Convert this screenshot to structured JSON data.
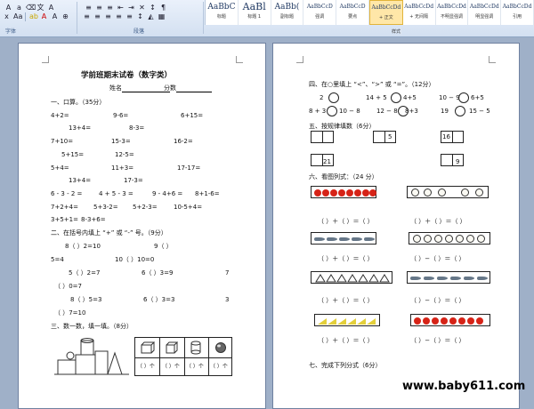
{
  "ribbon": {
    "groups": {
      "font": "字体",
      "paragraph": "段落",
      "styles": "样式"
    },
    "styles": [
      {
        "sample": "AaBbC",
        "name": "标题"
      },
      {
        "sample": "AaBl",
        "name": "标题 1"
      },
      {
        "sample": "AaBb(",
        "name": "副标题"
      },
      {
        "sample": "AaBbCcD",
        "name": "强调"
      },
      {
        "sample": "AaBbCcD",
        "name": "要点"
      },
      {
        "sample": "AaBbCcDd",
        "name": "+ 正文"
      },
      {
        "sample": "AaBbCcDd",
        "name": "+ 无间隔"
      },
      {
        "sample": "AaBbCcDd",
        "name": "不明显强调"
      },
      {
        "sample": "AaBbCcDd",
        "name": "明显强调"
      },
      {
        "sample": "AaBbCcDd",
        "name": "引用"
      }
    ]
  },
  "page1": {
    "title": "学前班期末试卷（数字类）",
    "name_label": "姓名",
    "score_label": "分数",
    "s1": "一、口算。（35分）",
    "r1": [
      "4+2=",
      "9-6=",
      "6+15="
    ],
    "r2": [
      "13+4=",
      "8-3="
    ],
    "r3": [
      "7+10=",
      "15-3=",
      "16-2="
    ],
    "r4": [
      "5+15=",
      "12-5="
    ],
    "r5": [
      "5+4=",
      "11+3=",
      "17-17="
    ],
    "r6": [
      "13+4=",
      "17-3="
    ],
    "r7": [
      "6 - 3 - 2 =",
      "4 + 5 - 3 =",
      "9 - 4+6 =",
      "8+1-6="
    ],
    "r8": [
      "7+2+4=",
      "5+3-2=",
      "5+2-3=",
      "10-5+4="
    ],
    "r9": [
      "3+5+1=",
      "8-3+6="
    ],
    "s2": "二、在括号内填上 “+” 或 “-” 号。（9分）",
    "q1": [
      "8（       ）2=10",
      "9（       ）"
    ],
    "q2": [
      "5=4",
      "10（       ）10=0"
    ],
    "q3": [
      "5（       ）2=7",
      "6（       ）3=9",
      "7"
    ],
    "q4": "（       ）0=7",
    "q5": [
      "8（       ）5=3",
      "6（       ）3=3",
      "3"
    ],
    "q6": "（       ）7=10",
    "s3": "三、数一数，填一填。（8分）",
    "count_cells": [
      "（ ）个",
      "（ ）个",
      "（ ）个",
      "（ ）个"
    ]
  },
  "page2": {
    "s4": "四、在○里填上 “<”、“>” 或 “=”。（12分）",
    "c1": [
      "2",
      "14 + 5",
      "4+5",
      "10 − 9",
      "6+5"
    ],
    "c2": [
      "8 + 3",
      "10 − 8",
      "12 − 8",
      "8+3",
      "19",
      "15 − 5"
    ],
    "s5": "五、按规律填数（6分）",
    "seq": [
      "5",
      "16",
      "21",
      "9"
    ],
    "s6": "六、看图列式：（24 分）",
    "blank_row": "（    ）＋（    ）＝（    ）",
    "blank_row_minus": "（    ）−（    ）＝（    ）",
    "s7": "七、完成下列分式（6分）"
  },
  "watermark": "www.baby611.com"
}
